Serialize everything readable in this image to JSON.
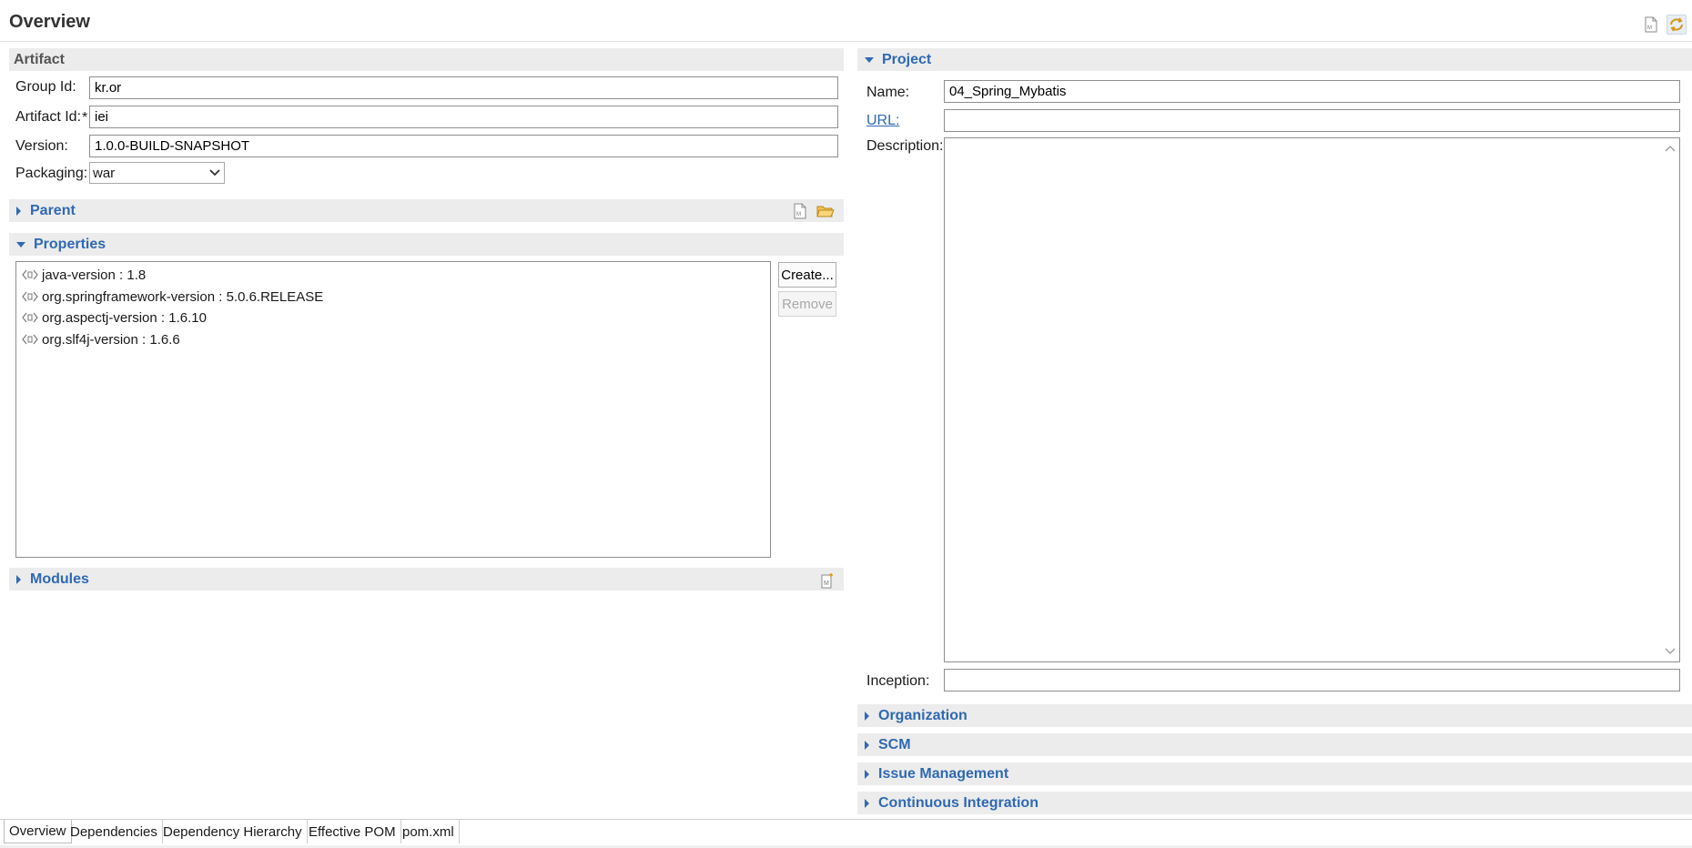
{
  "header": {
    "title": "Overview",
    "icons": [
      "pom-file-icon",
      "sync-icon"
    ]
  },
  "artifact": {
    "title": "Artifact",
    "group_id_label": "Group Id:",
    "group_id_value": "kr.or",
    "artifact_id_label": "Artifact Id:",
    "artifact_id_required": "*",
    "artifact_id_value": "iei",
    "version_label": "Version:",
    "version_value": "1.0.0-BUILD-SNAPSHOT",
    "packaging_label": "Packaging:",
    "packaging_value": "war"
  },
  "parent": {
    "title": "Parent"
  },
  "properties": {
    "title": "Properties",
    "items": [
      "java-version : 1.8",
      "org.springframework-version : 5.0.6.RELEASE",
      "org.aspectj-version : 1.6.10",
      "org.slf4j-version : 1.6.6"
    ],
    "create_label": "Create...",
    "remove_label": "Remove"
  },
  "modules": {
    "title": "Modules"
  },
  "project": {
    "title": "Project",
    "name_label": "Name:",
    "name_value": "04_Spring_Mybatis",
    "url_label": "URL:",
    "url_value": "",
    "description_label": "Description:",
    "description_value": "",
    "inception_label": "Inception:",
    "inception_value": ""
  },
  "collapsed_sections": [
    "Organization",
    "SCM",
    "Issue Management",
    "Continuous Integration"
  ],
  "tabs": [
    "Overview",
    "Dependencies",
    "Dependency Hierarchy",
    "Effective POM",
    "pom.xml"
  ],
  "active_tab": "Overview",
  "colors": {
    "section_title": "#2f69b2",
    "section_bar": "#ececec"
  }
}
